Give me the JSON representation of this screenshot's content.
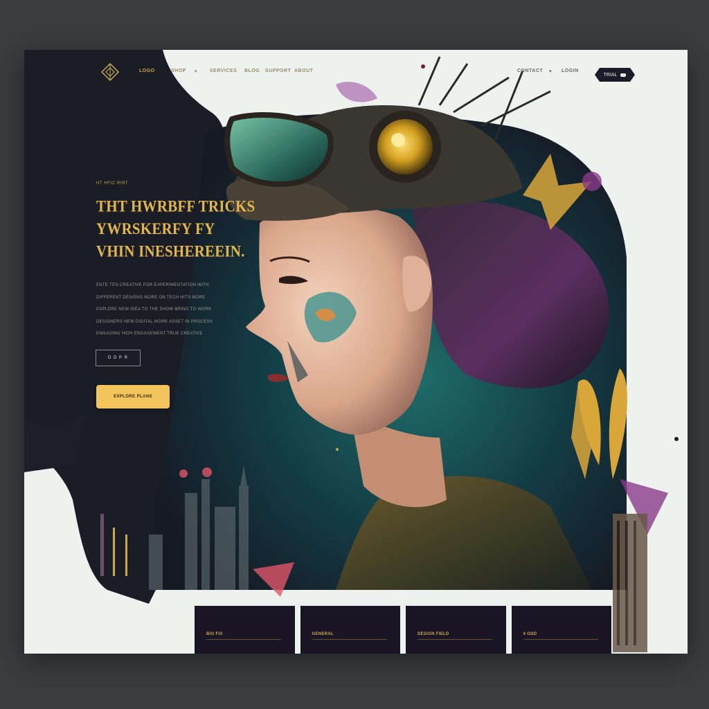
{
  "nav": {
    "links": [
      "LOGO",
      "SHOP",
      "SERVICES",
      "BLOG",
      "SUPPORT",
      "ABOUT"
    ],
    "right_links": [
      "CONTACT",
      "LOGIN"
    ],
    "cta_label": "TRIAL"
  },
  "hero": {
    "eyebrow": "HT HFIC RIRT",
    "headline": "THT HWRBFF TRICKS YWRSKERFY FY VHIN INESHEREEIN.",
    "body_lines": [
      "ENTE TEN CREATIVE FOR EXPERIMENTATION WITH",
      "DIFFERENT DESIGNS MORE ON TECH HITS MORE",
      "EXPLORE NEW IDEA TO THE SHOW BRING TO WORK",
      "DESIGNERS NEW DIGITAL WORK ASSET IN PROCESS",
      "ENGAGING HIGH ENGAGEMENT TRUE CREATIVE"
    ],
    "outline_button": "D D P R",
    "primary_button": "EXPLORE PLANS"
  },
  "cards": [
    {
      "label": "BIG FIX"
    },
    {
      "label": "GENERAL"
    },
    {
      "label": "DESIGN FIELD"
    },
    {
      "label": "4 ODD"
    }
  ],
  "colors": {
    "accent": "#f2c45c",
    "headline": "#e3b64a",
    "dark_panel": "#1a1c26",
    "frame_bg": "#eef2ef",
    "card_bg": "#191524"
  }
}
